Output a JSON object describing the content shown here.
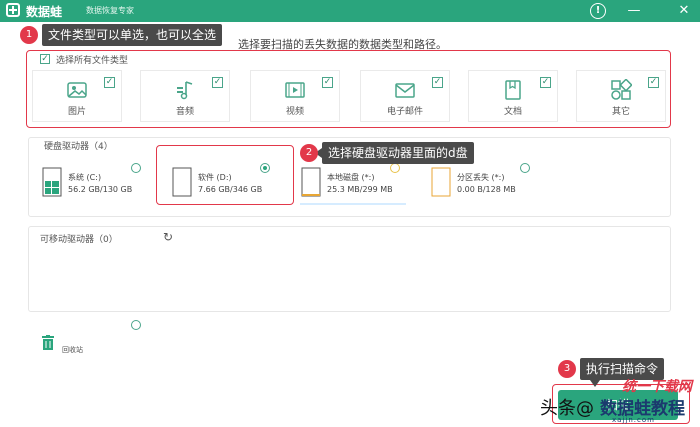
{
  "titlebar": {
    "app_name": "数据蛙",
    "app_subtitle": "数据恢复专家",
    "help_glyph": "!",
    "minimize_glyph": "—",
    "close_glyph": "✕"
  },
  "headline": "选择要扫描的丢失数据的数据类型和路径。",
  "callouts": [
    {
      "num": "1",
      "text": "文件类型可以单选，也可以全选"
    },
    {
      "num": "2",
      "text": "选择硬盘驱动器里面的d盘"
    },
    {
      "num": "3",
      "text": "执行扫描命令"
    }
  ],
  "file_types": {
    "select_all_label": "选择所有文件类型",
    "select_all_checked": true,
    "items": [
      {
        "label": "图片",
        "icon": "image-icon",
        "checked": true
      },
      {
        "label": "音频",
        "icon": "music-icon",
        "checked": true
      },
      {
        "label": "视频",
        "icon": "video-icon",
        "checked": true
      },
      {
        "label": "电子邮件",
        "icon": "email-icon",
        "checked": true
      },
      {
        "label": "文档",
        "icon": "document-icon",
        "checked": true
      },
      {
        "label": "其它",
        "icon": "other-icon",
        "checked": true
      }
    ]
  },
  "hard_drives": {
    "title": "硬盘驱动器（4）",
    "items": [
      {
        "name": "系统 (C:)",
        "size": "56.2 GB/130 GB",
        "icon": "windows-drive-icon",
        "selected": false
      },
      {
        "name": "软件 (D:)",
        "size": "7.66 GB/346 GB",
        "icon": "drive-icon",
        "selected": true
      },
      {
        "name": "本地磁盘 (*:)",
        "size": "25.3 MB/299 MB",
        "icon": "drive-icon",
        "selected": false
      },
      {
        "name": "分区丢失 (*:)",
        "size": "0.00  B/128 MB",
        "icon": "drive-icon",
        "selected": false
      }
    ]
  },
  "removable": {
    "title": "可移动驱动器（0）",
    "refresh_icon": "refresh-icon"
  },
  "recycle_bin": {
    "label": "回收站",
    "icon": "trash-icon"
  },
  "scan_button": "扫描",
  "watermark": {
    "prefix": "头条",
    "at": "@",
    "brand": "数据蛙教程",
    "stamp": "统一下载网",
    "url": "xajjn.com"
  },
  "colors": {
    "brand": "#2aa57d",
    "annotation_red": "#e2384a",
    "callout_bg": "#4a4a4a"
  }
}
